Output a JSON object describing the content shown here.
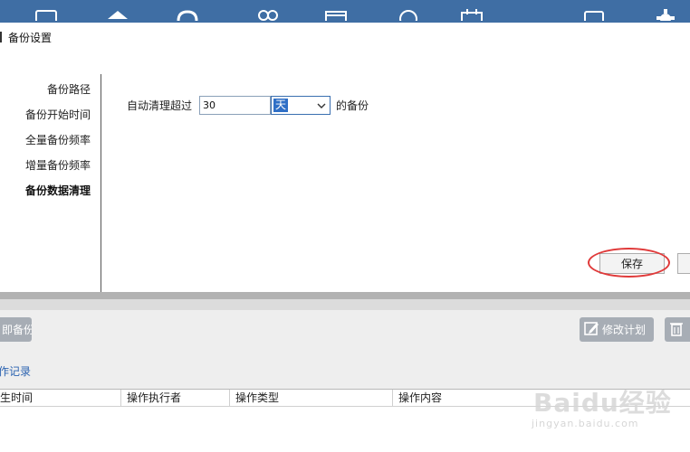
{
  "dialog": {
    "title": "备份设置"
  },
  "nav": {
    "items": [
      {
        "label": "备份路径",
        "active": false
      },
      {
        "label": "备份开始时间",
        "active": false
      },
      {
        "label": "全量备份频率",
        "active": false
      },
      {
        "label": "增量备份频率",
        "active": false
      },
      {
        "label": "备份数据清理",
        "active": true
      }
    ]
  },
  "cleanup": {
    "label": "自动清理超过",
    "value": "30",
    "unit": "天",
    "suffix": "的备份"
  },
  "actions": {
    "save_label": "保存"
  },
  "toolbar": {
    "backup_label": "即备份",
    "edit_plan_label": "修改计划"
  },
  "records": {
    "link_label": "作记录",
    "columns": [
      "生时间",
      "操作执行者",
      "操作类型",
      "操作内容"
    ]
  },
  "watermark": {
    "brand": "Baidu经验",
    "url": "jingyan.baidu.com"
  },
  "colors": {
    "topbar": "#3f6ea4",
    "button_gray": "#a7adb5",
    "selection_blue": "#2f6fc6",
    "highlight_ring": "#e03a3a",
    "link_blue": "#2a62b0"
  },
  "icons": [
    "monitor-icon",
    "home-icon",
    "cloud-icon",
    "users-icon",
    "screen-icon",
    "clock-icon",
    "calendar-icon",
    "display-icon",
    "gear-icon",
    "edit-icon",
    "trash-icon",
    "chevron-down-icon"
  ]
}
